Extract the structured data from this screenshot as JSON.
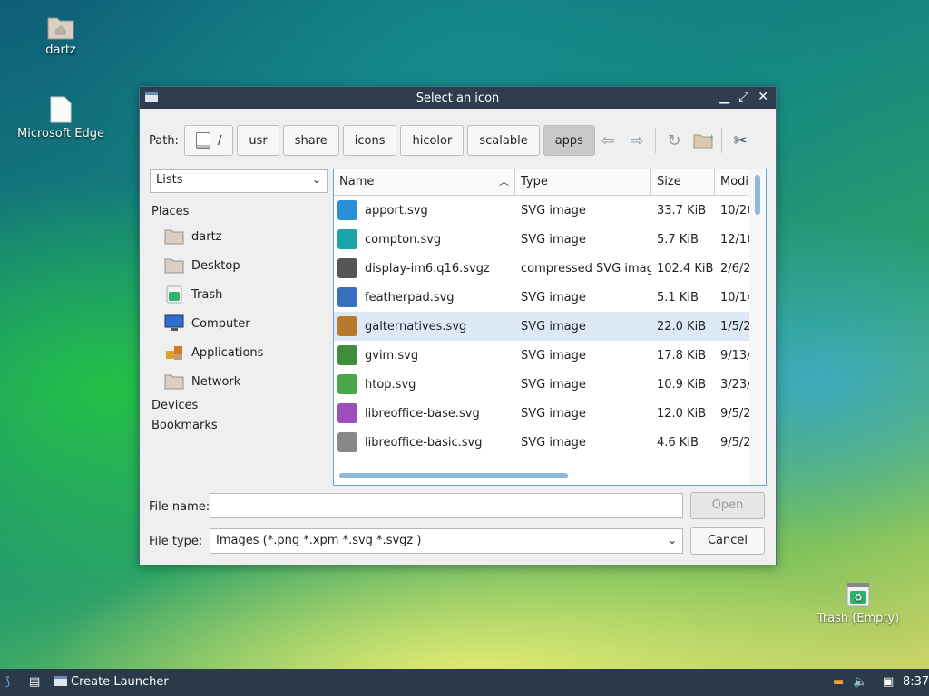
{
  "desktop": {
    "icons": [
      {
        "label": "dartz",
        "icon": "home-folder-icon"
      },
      {
        "label": "Microsoft Edge",
        "icon": "file-icon"
      },
      {
        "label": "Trash (Empty)",
        "icon": "trash-icon"
      }
    ]
  },
  "dialog": {
    "title": "Select an icon",
    "path_label": "Path:",
    "breadcrumbs": [
      "/",
      "usr",
      "share",
      "icons",
      "hicolor",
      "scalable",
      "apps"
    ],
    "active_crumb": "apps",
    "view_select": "Lists",
    "places": {
      "header": "Places",
      "items": [
        {
          "label": "dartz",
          "icon": "home-folder-icon"
        },
        {
          "label": "Desktop",
          "icon": "desktop-folder-icon"
        },
        {
          "label": "Trash",
          "icon": "trash-icon"
        },
        {
          "label": "Computer",
          "icon": "computer-icon"
        },
        {
          "label": "Applications",
          "icon": "applications-icon"
        },
        {
          "label": "Network",
          "icon": "network-folder-icon"
        }
      ],
      "devices": "Devices",
      "bookmarks": "Bookmarks"
    },
    "columns": {
      "name": "Name",
      "type": "Type",
      "size": "Size",
      "modified": "Modi"
    },
    "files": [
      {
        "name": "apport.svg",
        "type": "SVG image",
        "size": "33.7 KiB",
        "modified": "10/26",
        "color": "#2a8fd6"
      },
      {
        "name": "compton.svg",
        "type": "SVG image",
        "size": "5.7 KiB",
        "modified": "12/16",
        "color": "#1aa3a8"
      },
      {
        "name": "display-im6.q16.svgz",
        "type": "compressed SVG image",
        "size": "102.4 KiB",
        "modified": "2/6/2",
        "color": "#555555"
      },
      {
        "name": "featherpad.svg",
        "type": "SVG image",
        "size": "5.1 KiB",
        "modified": "10/14",
        "color": "#3a6fbf"
      },
      {
        "name": "galternatives.svg",
        "type": "SVG image",
        "size": "22.0 KiB",
        "modified": "1/5/2",
        "color": "#b77a2d"
      },
      {
        "name": "gvim.svg",
        "type": "SVG image",
        "size": "17.8 KiB",
        "modified": "9/13/",
        "color": "#3f8f3a"
      },
      {
        "name": "htop.svg",
        "type": "SVG image",
        "size": "10.9 KiB",
        "modified": "3/23/",
        "color": "#4aa84a"
      },
      {
        "name": "libreoffice-base.svg",
        "type": "SVG image",
        "size": "12.0 KiB",
        "modified": "9/5/2",
        "color": "#9b4fbf"
      },
      {
        "name": "libreoffice-basic.svg",
        "type": "SVG image",
        "size": "4.6 KiB",
        "modified": "9/5/2",
        "color": "#888888"
      }
    ],
    "selected_file": "galternatives.svg",
    "file_name_label": "File name:",
    "file_name_value": "",
    "file_type_label": "File type:",
    "file_type_value": "Images (*.png *.xpm *.svg *.svgz )",
    "open_label": "Open",
    "cancel_label": "Cancel"
  },
  "taskbar": {
    "launcher_label": "Create Launcher",
    "clock": "8:37"
  }
}
